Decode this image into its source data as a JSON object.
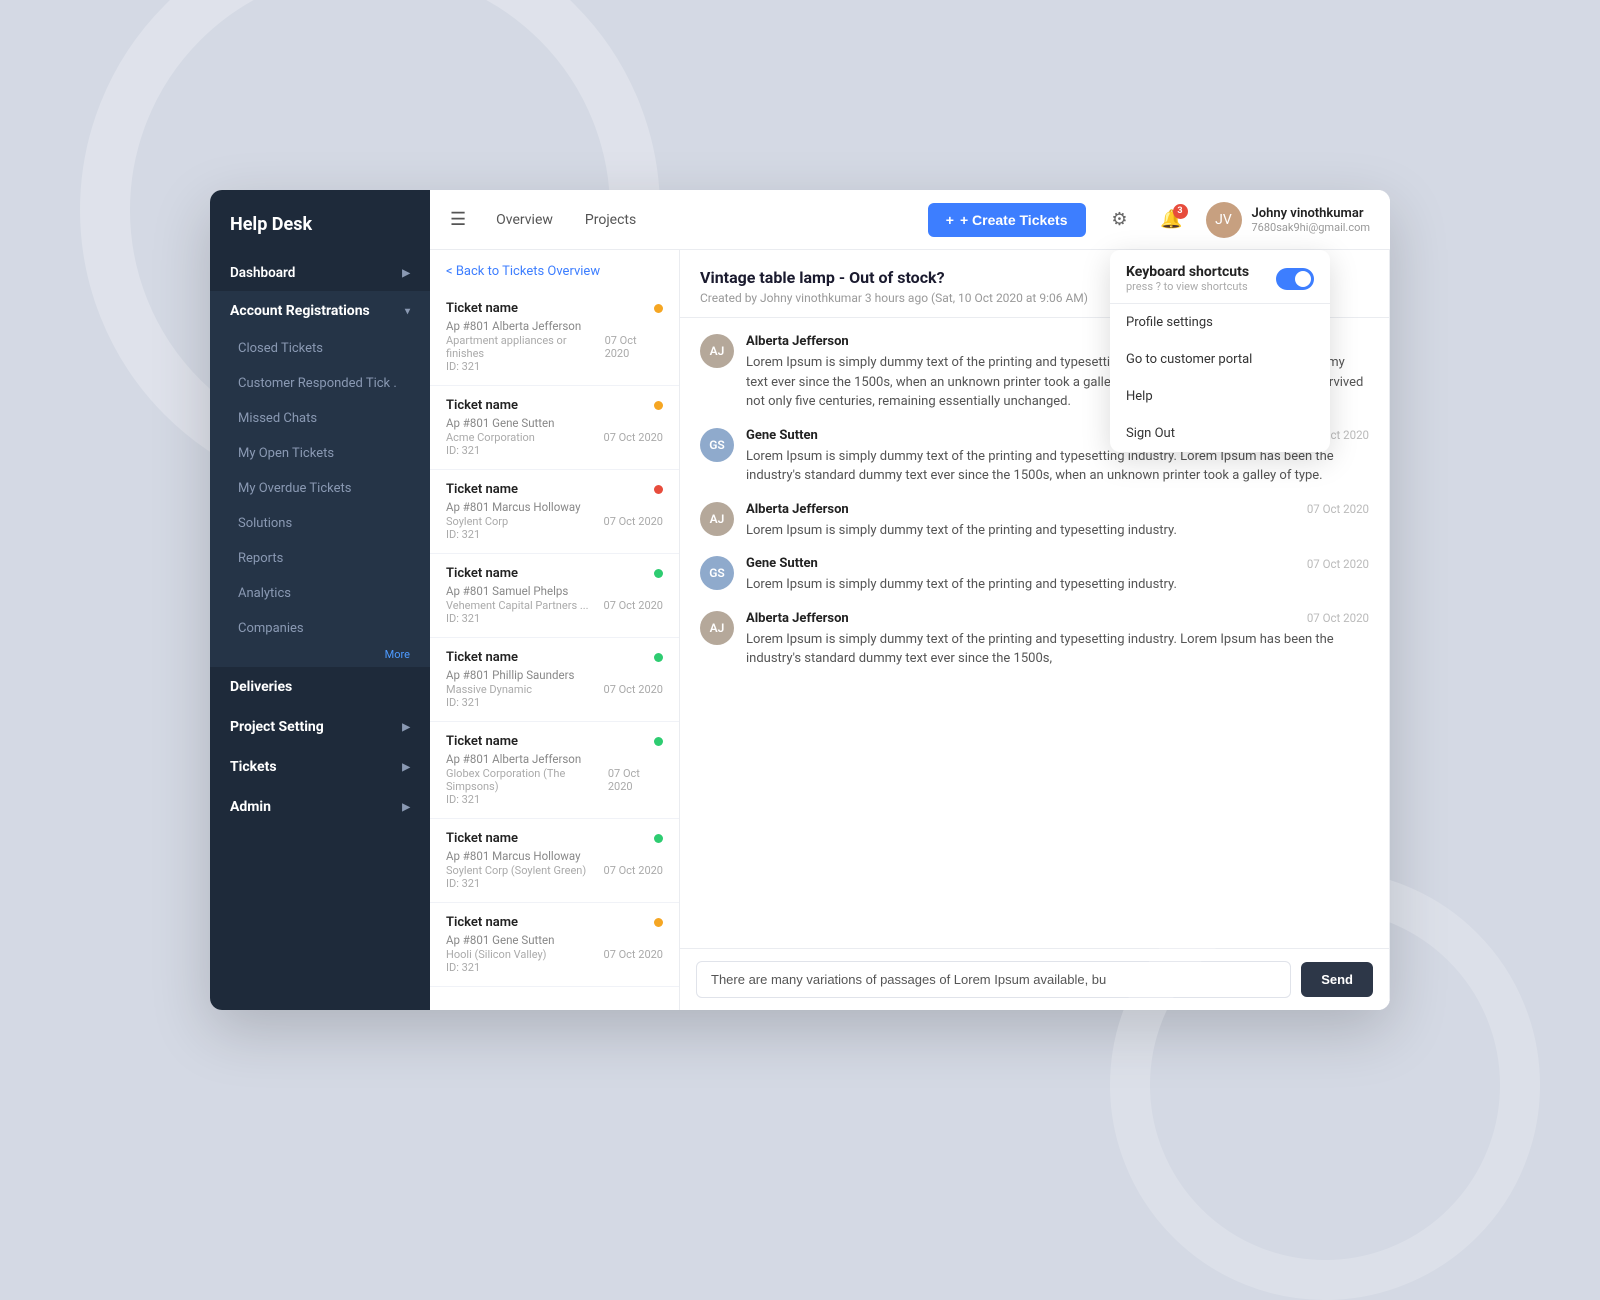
{
  "app": {
    "title": "Help Desk"
  },
  "sidebar": {
    "logo": "Help Desk",
    "items": [
      {
        "id": "dashboard",
        "label": "Dashboard",
        "type": "parent",
        "hasArrow": true
      },
      {
        "id": "account-registrations",
        "label": "Account Registrations",
        "type": "parent-expanded",
        "hasArrow": true
      },
      {
        "id": "closed-tickets",
        "label": "Closed Tickets",
        "type": "sub"
      },
      {
        "id": "customer-responded",
        "label": "Customer Responded Tick .",
        "type": "sub"
      },
      {
        "id": "missed-chats",
        "label": "Missed Chats",
        "type": "sub"
      },
      {
        "id": "my-open-tickets",
        "label": "My Open Tickets",
        "type": "sub"
      },
      {
        "id": "my-overdue-tickets",
        "label": "My Overdue Tickets",
        "type": "sub"
      },
      {
        "id": "solutions",
        "label": "Solutions",
        "type": "sub"
      },
      {
        "id": "reports",
        "label": "Reports",
        "type": "sub"
      },
      {
        "id": "analytics",
        "label": "Analytics",
        "type": "sub"
      },
      {
        "id": "companies",
        "label": "Companies",
        "type": "sub"
      },
      {
        "id": "more",
        "label": "More",
        "type": "more"
      },
      {
        "id": "deliveries",
        "label": "Deliveries",
        "type": "parent",
        "hasArrow": false
      },
      {
        "id": "project-setting",
        "label": "Project Setting",
        "type": "parent",
        "hasArrow": true
      },
      {
        "id": "tickets",
        "label": "Tickets",
        "type": "parent",
        "hasArrow": true
      },
      {
        "id": "admin",
        "label": "Admin",
        "type": "parent",
        "hasArrow": true
      }
    ]
  },
  "topbar": {
    "hamburger_icon": "☰",
    "nav_items": [
      {
        "id": "overview",
        "label": "Overview",
        "active": false
      },
      {
        "id": "projects",
        "label": "Projects",
        "active": false
      }
    ],
    "create_tickets_label": "+ Create Tickets",
    "notification_count": "3",
    "user": {
      "name": "Johny vinothkumar",
      "email": "7680sak9hi@gmail.com"
    }
  },
  "ticket_list": {
    "back_label": "< Back to Tickets Overview",
    "tickets": [
      {
        "name": "Ticket name",
        "person": "Ap #801  Alberta Jefferson",
        "company": "Apartment appliances or finishes",
        "date": "07 Oct 2020",
        "id": "ID: 321",
        "dot_color": "#f5a623"
      },
      {
        "name": "Ticket name",
        "person": "Ap #801  Gene Sutten",
        "company": "Acme Corporation",
        "date": "07 Oct 2020",
        "id": "ID: 321",
        "dot_color": "#f5a623"
      },
      {
        "name": "Ticket name",
        "person": "Ap #801  Marcus Holloway",
        "company": "Soylent Corp",
        "date": "07 Oct 2020",
        "id": "ID: 321",
        "dot_color": "#e74c3c"
      },
      {
        "name": "Ticket name",
        "person": "Ap #801  Samuel Phelps",
        "company": "Vehement Capital Partners ...",
        "date": "07 Oct 2020",
        "id": "ID: 321",
        "dot_color": "#2ecc71"
      },
      {
        "name": "Ticket name",
        "person": "Ap #801  Phillip Saunders",
        "company": "Massive Dynamic",
        "date": "07 Oct 2020",
        "id": "ID: 321",
        "dot_color": "#2ecc71"
      },
      {
        "name": "Ticket name",
        "person": "Ap #801  Alberta Jefferson",
        "company": "Globex Corporation (The Simpsons)",
        "date": "07 Oct 2020",
        "id": "ID: 321",
        "dot_color": "#2ecc71"
      },
      {
        "name": "Ticket name",
        "person": "Ap #801  Marcus Holloway",
        "company": "Soylent Corp (Soylent Green)",
        "date": "07 Oct 2020",
        "id": "ID: 321",
        "dot_color": "#2ecc71"
      },
      {
        "name": "Ticket name",
        "person": "Ap #801  Gene Sutten",
        "company": "Hooli (Silicon Valley)",
        "date": "07 Oct 2020",
        "id": "ID: 321",
        "dot_color": "#f5a623"
      }
    ]
  },
  "conversation": {
    "title": "Vintage table lamp - Out of stock?",
    "meta": "Created by Johny vinothkumar 3 hours ago (Sat, 10 Oct 2020 at 9:06 AM)",
    "messages": [
      {
        "author": "Alberta Jefferson",
        "time": "",
        "avatar_class": "av-alberta",
        "avatar_initials": "AJ",
        "text": "Lorem Ipsum is simply dummy text of the printing and typesetting industry. Lorem Ipsum has be dummy text ever since the 1500s, when an unknown printer took a galley of type and scramble book. It has survived not only five centuries,  remaining essentially unchanged."
      },
      {
        "author": "Gene Sutten",
        "time": "07 Oct 2020",
        "avatar_class": "av-gene",
        "avatar_initials": "GS",
        "text": "Lorem Ipsum is simply dummy text of the printing and typesetting industry. Lorem Ipsum has been the industry's standard dummy text ever since the 1500s, when an unknown printer took a galley of type."
      },
      {
        "author": "Alberta Jefferson",
        "time": "07 Oct 2020",
        "avatar_class": "av-alberta",
        "avatar_initials": "AJ",
        "text": "Lorem Ipsum is simply dummy text of the printing and typesetting industry."
      },
      {
        "author": "Gene Sutten",
        "time": "07 Oct 2020",
        "avatar_class": "av-gene",
        "avatar_initials": "GS",
        "text": "Lorem Ipsum is simply dummy text of the printing and typesetting industry."
      },
      {
        "author": "Alberta Jefferson",
        "time": "07 Oct 2020",
        "avatar_class": "av-alberta",
        "avatar_initials": "AJ",
        "text": "Lorem Ipsum is simply dummy text of the printing and typesetting industry. Lorem Ipsum has been the industry's standard dummy text ever since the 1500s,"
      }
    ],
    "input_placeholder": "There are many variations of passages of Lorem Ipsum available, bu",
    "send_label": "Send"
  },
  "dropdown": {
    "title": "Keyboard shortcuts",
    "subtitle": "press ? to view shortcuts",
    "toggle_state": "on",
    "items": [
      {
        "id": "profile-settings",
        "label": "Profile settings"
      },
      {
        "id": "customer-portal",
        "label": "Go to customer portal"
      },
      {
        "id": "help",
        "label": "Help"
      },
      {
        "id": "sign-out",
        "label": "Sign Out"
      }
    ]
  }
}
